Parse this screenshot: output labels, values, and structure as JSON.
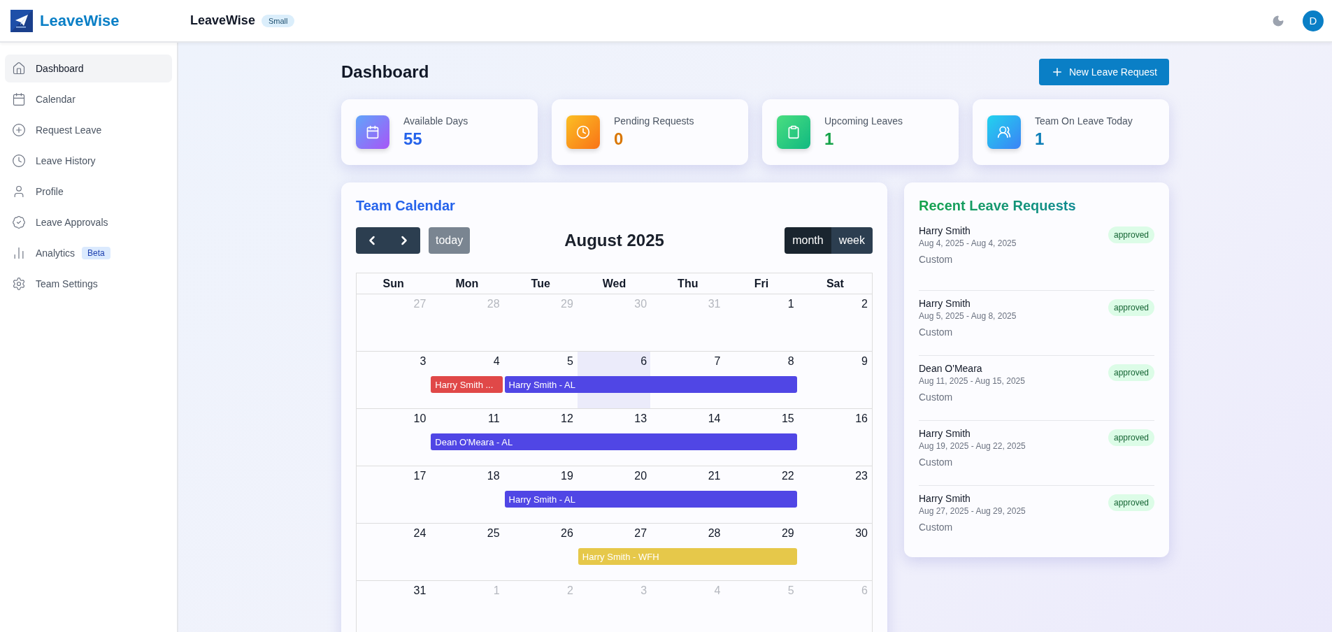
{
  "brand": {
    "name": "LeaveWise"
  },
  "header": {
    "title": "LeaveWise",
    "plan_badge": "Small",
    "avatar": "D"
  },
  "sidebar": {
    "items": [
      {
        "label": "Dashboard",
        "selected": true
      },
      {
        "label": "Calendar",
        "selected": false
      },
      {
        "label": "Request Leave",
        "selected": false
      },
      {
        "label": "Leave History",
        "selected": false
      },
      {
        "label": "Profile",
        "selected": false
      },
      {
        "label": "Leave Approvals",
        "selected": false
      },
      {
        "label": "Analytics",
        "selected": false,
        "badge": "Beta"
      },
      {
        "label": "Team Settings",
        "selected": false
      }
    ]
  },
  "page": {
    "title": "Dashboard",
    "new_button": "New Leave Request"
  },
  "stats": [
    {
      "kind": "available",
      "label": "Available Days",
      "value": "55"
    },
    {
      "kind": "pending",
      "label": "Pending Requests",
      "value": "0"
    },
    {
      "kind": "upcoming",
      "label": "Upcoming Leaves",
      "value": "1"
    },
    {
      "kind": "team",
      "label": "Team On Leave Today",
      "value": "1"
    }
  ],
  "calendar": {
    "title": "Team Calendar",
    "today_button": "today",
    "month_title": "August 2025",
    "views": [
      {
        "label": "month",
        "selected": true
      },
      {
        "label": "week",
        "selected": false
      }
    ],
    "weekdays": [
      "Sun",
      "Mon",
      "Tue",
      "Wed",
      "Thu",
      "Fri",
      "Sat"
    ],
    "weeks": [
      {
        "days": [
          {
            "label": "27",
            "muted": true,
            "today": false
          },
          {
            "label": "28",
            "muted": true,
            "today": false
          },
          {
            "label": "29",
            "muted": true,
            "today": false
          },
          {
            "label": "30",
            "muted": true,
            "today": false
          },
          {
            "label": "31",
            "muted": true,
            "today": false
          },
          {
            "label": "1",
            "muted": false,
            "today": false
          },
          {
            "label": "2",
            "muted": false,
            "today": false
          }
        ]
      },
      {
        "days": [
          {
            "label": "3",
            "muted": false,
            "today": false
          },
          {
            "label": "4",
            "muted": false,
            "today": false,
            "bar": {
              "title": "Harry Smith ...",
              "color": "#e04848"
            }
          },
          {
            "label": "5",
            "muted": false,
            "today": false,
            "bar": {
              "title": "Harry Smith - AL",
              "color": "#5046e5"
            }
          },
          {
            "label": "6",
            "muted": false,
            "today": true,
            "bar": {
              "color": "#5046e5"
            }
          },
          {
            "label": "7",
            "muted": false,
            "today": false,
            "bar": {
              "color": "#5046e5"
            }
          },
          {
            "label": "8",
            "muted": false,
            "today": false,
            "bar": {
              "color": "#5046e5"
            }
          },
          {
            "label": "9",
            "muted": false,
            "today": false
          }
        ]
      },
      {
        "days": [
          {
            "label": "10",
            "muted": false,
            "today": false
          },
          {
            "label": "11",
            "muted": false,
            "today": false,
            "bar": {
              "title": "Dean O'Meara - AL",
              "color": "#5046e5"
            }
          },
          {
            "label": "12",
            "muted": false,
            "today": false,
            "bar": {
              "color": "#5046e5"
            }
          },
          {
            "label": "13",
            "muted": false,
            "today": false,
            "bar": {
              "color": "#5046e5"
            }
          },
          {
            "label": "14",
            "muted": false,
            "today": false,
            "bar": {
              "color": "#5046e5"
            }
          },
          {
            "label": "15",
            "muted": false,
            "today": false,
            "bar": {
              "color": "#5046e5"
            }
          },
          {
            "label": "16",
            "muted": false,
            "today": false
          }
        ]
      },
      {
        "days": [
          {
            "label": "17",
            "muted": false,
            "today": false
          },
          {
            "label": "18",
            "muted": false,
            "today": false
          },
          {
            "label": "19",
            "muted": false,
            "today": false,
            "bar": {
              "title": "Harry Smith - AL",
              "color": "#5046e5"
            }
          },
          {
            "label": "20",
            "muted": false,
            "today": false,
            "bar": {
              "color": "#5046e5"
            }
          },
          {
            "label": "21",
            "muted": false,
            "today": false,
            "bar": {
              "color": "#5046e5"
            }
          },
          {
            "label": "22",
            "muted": false,
            "today": false,
            "bar": {
              "color": "#5046e5"
            }
          },
          {
            "label": "23",
            "muted": false,
            "today": false
          }
        ]
      },
      {
        "days": [
          {
            "label": "24",
            "muted": false,
            "today": false
          },
          {
            "label": "25",
            "muted": false,
            "today": false
          },
          {
            "label": "26",
            "muted": false,
            "today": false
          },
          {
            "label": "27",
            "muted": false,
            "today": false,
            "bar": {
              "title": "Harry Smith - WFH",
              "color": "#e6c84a"
            }
          },
          {
            "label": "28",
            "muted": false,
            "today": false,
            "bar": {
              "color": "#e6c84a"
            }
          },
          {
            "label": "29",
            "muted": false,
            "today": false,
            "bar": {
              "color": "#e6c84a"
            }
          },
          {
            "label": "30",
            "muted": false,
            "today": false
          }
        ]
      },
      {
        "days": [
          {
            "label": "31",
            "muted": false,
            "today": false
          },
          {
            "label": "1",
            "muted": true,
            "today": false
          },
          {
            "label": "2",
            "muted": true,
            "today": false
          },
          {
            "label": "3",
            "muted": true,
            "today": false
          },
          {
            "label": "4",
            "muted": true,
            "today": false
          },
          {
            "label": "5",
            "muted": true,
            "today": false
          },
          {
            "label": "6",
            "muted": true,
            "today": false
          }
        ]
      }
    ]
  },
  "recent": {
    "title": "Recent Leave Requests",
    "items": [
      {
        "name": "Harry Smith",
        "dates": "Aug 4, 2025 - Aug 4, 2025",
        "type": "Custom",
        "status": "approved"
      },
      {
        "name": "Harry Smith",
        "dates": "Aug 5, 2025 - Aug 8, 2025",
        "type": "Custom",
        "status": "approved"
      },
      {
        "name": "Dean O'Meara",
        "dates": "Aug 11, 2025 - Aug 15, 2025",
        "type": "Custom",
        "status": "approved"
      },
      {
        "name": "Harry Smith",
        "dates": "Aug 19, 2025 - Aug 22, 2025",
        "type": "Custom",
        "status": "approved"
      },
      {
        "name": "Harry Smith",
        "dates": "Aug 27, 2025 - Aug 29, 2025",
        "type": "Custom",
        "status": "approved"
      }
    ]
  }
}
